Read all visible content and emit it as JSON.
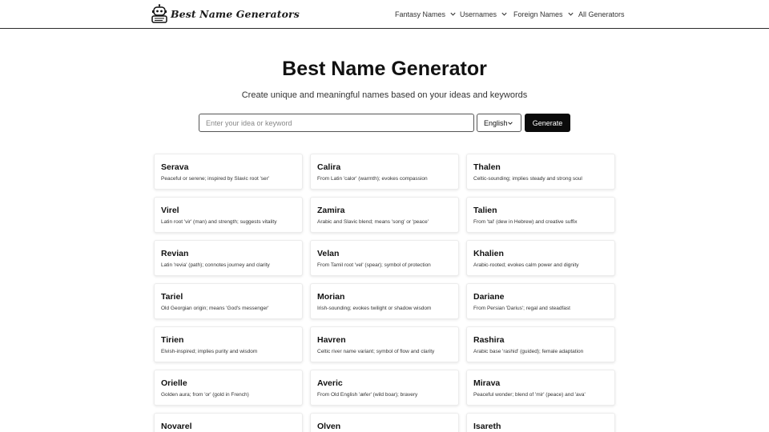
{
  "header": {
    "brand": "Best Name Generators",
    "nav": [
      {
        "label": "Fantasy Names",
        "dropdown": true
      },
      {
        "label": "Usernames",
        "dropdown": true
      },
      {
        "label": "Foreign Names",
        "dropdown": true
      },
      {
        "label": "All Generators",
        "dropdown": false
      }
    ]
  },
  "hero": {
    "title": "Best Name Generator",
    "subtitle": "Create unique and meaningful names based on your ideas and keywords"
  },
  "search": {
    "placeholder": "Enter your idea or keyword",
    "value": "",
    "language": "English",
    "generate_label": "Generate"
  },
  "results": [
    {
      "name": "Serava",
      "desc": "Peaceful or serene; inspired by Slavic root 'ser'"
    },
    {
      "name": "Calira",
      "desc": "From Latin 'calor' (warmth); evokes compassion"
    },
    {
      "name": "Thalen",
      "desc": "Celtic-sounding; implies steady and strong soul"
    },
    {
      "name": "Virel",
      "desc": "Latin root 'vir' (man) and strength; suggests vitality"
    },
    {
      "name": "Zamira",
      "desc": "Arabic and Slavic blend; means 'song' or 'peace'"
    },
    {
      "name": "Talien",
      "desc": "From 'tal' (dew in Hebrew) and creative suffix"
    },
    {
      "name": "Revian",
      "desc": "Latin 'revia' (path); connotes journey and clarity"
    },
    {
      "name": "Velan",
      "desc": "From Tamil root 'vel' (spear); symbol of protection"
    },
    {
      "name": "Khalien",
      "desc": "Arabic-rooted; evokes calm power and dignity"
    },
    {
      "name": "Tariel",
      "desc": "Old Georgian origin; means 'God's messenger'"
    },
    {
      "name": "Morian",
      "desc": "Irish-sounding; evokes twilight or shadow wisdom"
    },
    {
      "name": "Dariane",
      "desc": "From Persian 'Darius'; regal and steadfast"
    },
    {
      "name": "Tirien",
      "desc": "Elvish-inspired; implies purity and wisdom"
    },
    {
      "name": "Havren",
      "desc": "Celtic river name variant; symbol of flow and clarity"
    },
    {
      "name": "Rashira",
      "desc": "Arabic base 'rashid' (guided); female adaptation"
    },
    {
      "name": "Orielle",
      "desc": "Golden aura; from 'or' (gold in French)"
    },
    {
      "name": "Averic",
      "desc": "From Old English 'æfer' (wild boar); bravery"
    },
    {
      "name": "Mirava",
      "desc": "Peaceful wonder; blend of 'mir' (peace) and 'ava'"
    },
    {
      "name": "Novarel",
      "desc": ""
    },
    {
      "name": "Olven",
      "desc": ""
    },
    {
      "name": "Isareth",
      "desc": ""
    }
  ]
}
